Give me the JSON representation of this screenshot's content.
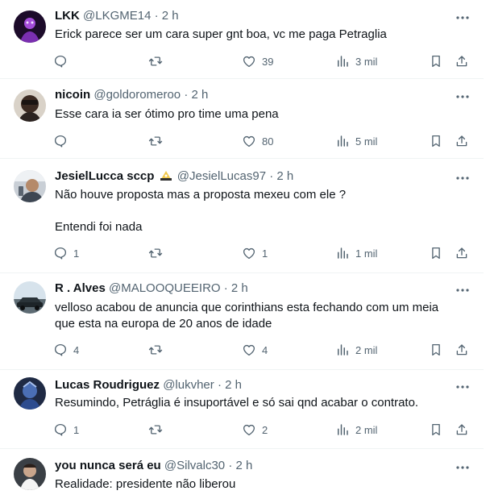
{
  "tweets": [
    {
      "name": "LKK",
      "handle": "@LKGME14",
      "dot": "·",
      "time": "2 h",
      "text": "Erick parece ser um cara super gnt boa, vc me paga Petraglia",
      "replies": "",
      "retweets": "",
      "likes": "39",
      "views": "3 mil",
      "avatar_icon": "avatar-purple-figure"
    },
    {
      "name": "nicoin",
      "handle": "@goldoromeroo",
      "dot": "·",
      "time": "2 h",
      "text": "Esse cara ia ser ótimo pro time uma pena",
      "replies": "",
      "retweets": "",
      "likes": "80",
      "views": "5 mil",
      "avatar_icon": "avatar-dark-face"
    },
    {
      "name": "JesielLucca sccp",
      "handle": "@JesielLucas97",
      "dot": "·",
      "time": "2 h",
      "text": "Não houve proposta mas a proposta mexeu com ele ?\n\nEntendi foi nada",
      "replies": "1",
      "retweets": "",
      "likes": "1",
      "views": "1 mil",
      "avatar_icon": "avatar-person-selfie",
      "badge_icon": "emoji-badge-icon"
    },
    {
      "name": "R . Alves",
      "handle": "@MALOOQUEEIRO",
      "dot": "·",
      "time": "2 h",
      "text": "velloso acabou de anuncia que corinthians esta fechando com um meia\nque esta na europa de 20 anos de idade",
      "replies": "4",
      "retweets": "",
      "likes": "4",
      "views": "2 mil",
      "avatar_icon": "avatar-car-landscape"
    },
    {
      "name": "Lucas Roudriguez",
      "handle": "@lukvher",
      "dot": "·",
      "time": "2 h",
      "text": "Resumindo, Petráglia é insuportável e só sai qnd acabar o contrato.",
      "replies": "1",
      "retweets": "",
      "likes": "2",
      "views": "2 mil",
      "avatar_icon": "avatar-blue-character"
    },
    {
      "name": "you nunca será eu",
      "handle": "@Silvalc30",
      "dot": "·",
      "time": "2 h",
      "text": "Realidade: presidente não liberou",
      "avatar_icon": "avatar-person-white"
    }
  ],
  "colors": {
    "text": "#0f1419",
    "secondary": "#536471",
    "divider": "#eff3f4"
  }
}
